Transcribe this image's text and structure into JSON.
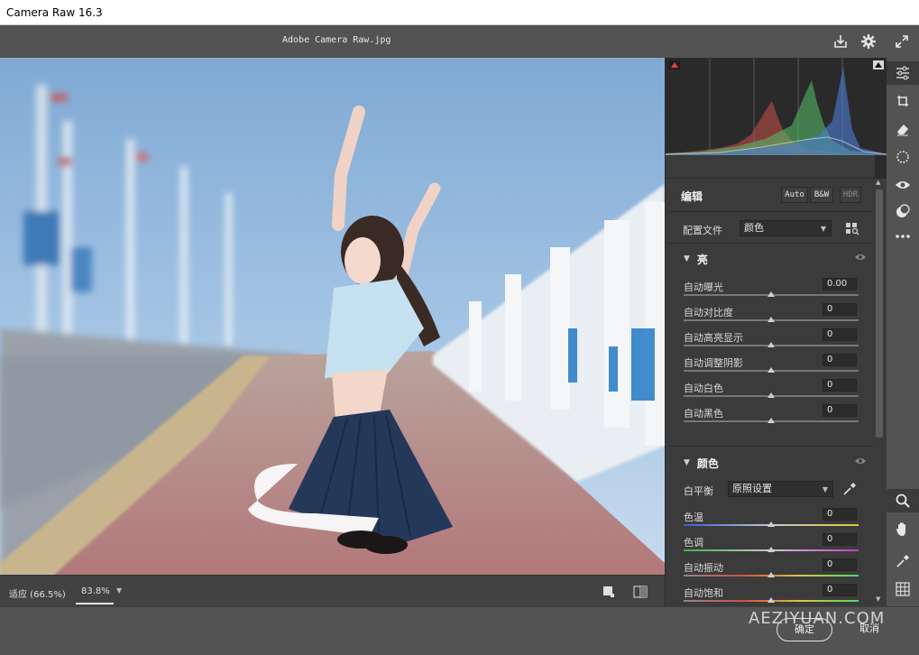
{
  "window": {
    "title": "Camera Raw 16.3"
  },
  "topbar": {
    "filename": "Adobe Camera Raw.jpg"
  },
  "edit_panel": {
    "title": "编辑",
    "mode_buttons": [
      "Auto",
      "B&W",
      "HDR"
    ],
    "profile_label": "配置文件",
    "profile_value": "颜色",
    "light_section": {
      "title": "亮",
      "sliders": [
        {
          "label": "自动曝光",
          "value": "0.00"
        },
        {
          "label": "自动对比度",
          "value": "0"
        },
        {
          "label": "自动高亮显示",
          "value": "0"
        },
        {
          "label": "自动调整阴影",
          "value": "0"
        },
        {
          "label": "自动白色",
          "value": "0"
        },
        {
          "label": "自动黑色",
          "value": "0"
        }
      ]
    },
    "color_section": {
      "title": "颜色",
      "wb_label": "白平衡",
      "wb_value": "原照设置",
      "sliders": [
        {
          "label": "色温",
          "value": "0"
        },
        {
          "label": "色调",
          "value": "0"
        },
        {
          "label": "自动振动",
          "value": "0"
        },
        {
          "label": "自动饱和",
          "value": "0"
        }
      ]
    }
  },
  "zoom": {
    "fit_label": "适应 (66.5%)",
    "current": "83.8%"
  },
  "footer": {
    "ok": "确定",
    "cancel": "取消",
    "watermark": "AEZIYUAN.COM"
  },
  "colors": {
    "panel": "#3b3b3b",
    "background": "#535353",
    "accent_blue": "#8fb4d8"
  },
  "icons": [
    "save-icon",
    "settings-icon",
    "fullscreen-icon",
    "edit-icon",
    "crop-icon",
    "eraser-icon",
    "mask-icon",
    "redeye-icon",
    "presets-icon",
    "more-icon",
    "zoom-icon",
    "hand-icon",
    "sampler-icon",
    "grid-icon"
  ]
}
